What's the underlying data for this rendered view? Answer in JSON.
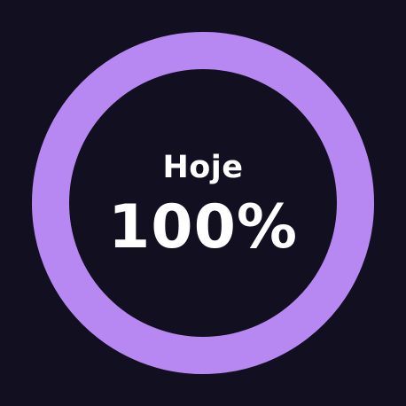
{
  "progress": {
    "label": "Hoje",
    "value_text": "100%",
    "fraction": 1.0
  },
  "colors": {
    "background": "#120f20",
    "ring": "#b888f2",
    "text": "#ffffff"
  }
}
